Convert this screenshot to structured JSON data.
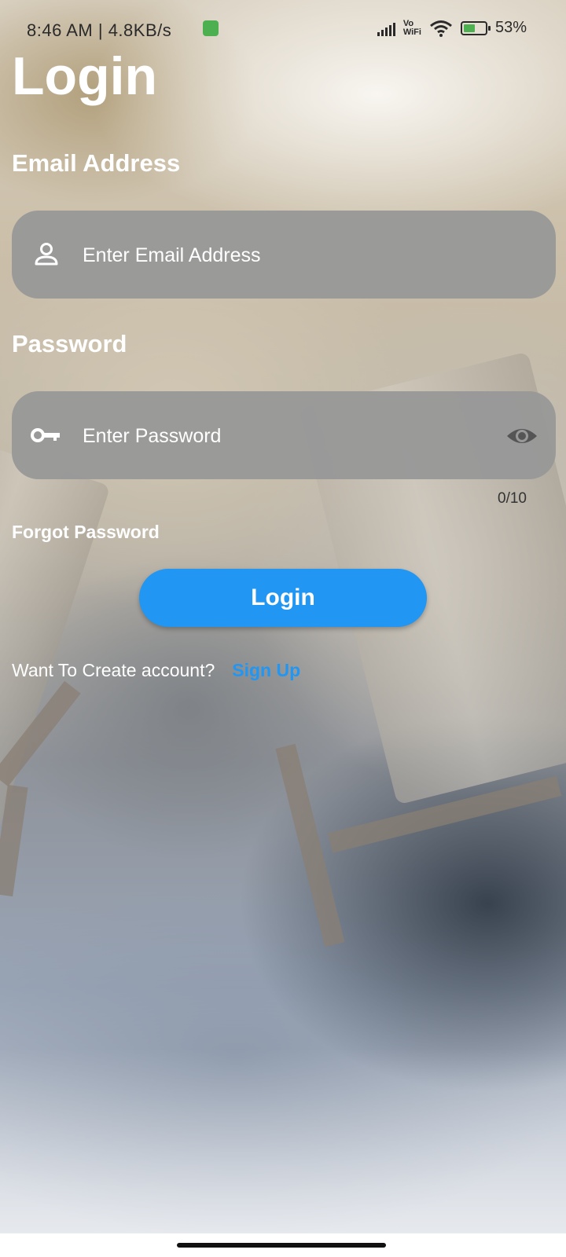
{
  "status_bar": {
    "time": "8:46 AM",
    "separator": "|",
    "network_speed": "4.8KB/s",
    "vowifi_top": "Vo",
    "vowifi_bottom": "WiFi",
    "battery_percent": "53%",
    "battery_level": 0.53,
    "colors": {
      "battery": "#4caf50",
      "app_icon": "#4caf50"
    },
    "icons": [
      "app-notification-icon",
      "signal-icon",
      "vowifi-icon",
      "wifi-icon",
      "battery-charging-icon"
    ]
  },
  "page": {
    "title": "Login"
  },
  "email": {
    "label": "Email Address",
    "placeholder": "Enter Email Address",
    "value": "",
    "icon": "person-icon"
  },
  "password": {
    "label": "Password",
    "placeholder": "Enter Password",
    "value": "",
    "icon": "key-icon",
    "toggle_icon": "eye-icon",
    "counter": "0/10"
  },
  "actions": {
    "forgot_password": "Forgot Password",
    "login_button": "Login",
    "signup_prompt": "Want To Create account?",
    "signup_link": "Sign Up"
  },
  "colors": {
    "accent": "#2196f3",
    "input_bg": "#989898",
    "label_text": "#ffffff"
  }
}
